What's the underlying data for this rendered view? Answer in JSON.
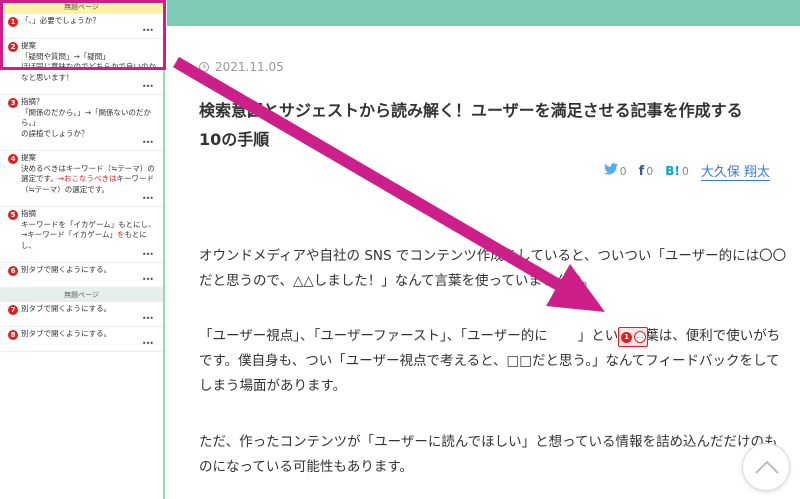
{
  "sidebar": {
    "section1_header": "無題ページ",
    "section2_header": "無題ページ",
    "comments": [
      {
        "num": "1",
        "title": "",
        "text": "「、」必要でしょうか？"
      },
      {
        "num": "2",
        "title": "提案",
        "text": "「疑問や質問」→「疑問」\nほぼ同じ意味なのでどちらかで良いのかなと思います！"
      },
      {
        "num": "3",
        "title": "指摘？",
        "text": "「関係のだから。」→「関係ないのだから。」\nの誤植でしょうか？"
      },
      {
        "num": "4",
        "title": "提案",
        "text_before": "決めるべきはキーワード（≒テーマ）の選定です。",
        "text_red": "→おこなうべきは",
        "text_after": "キーワード（≒テーマ）の選定です。"
      },
      {
        "num": "5",
        "title": "指摘",
        "text_before": "キーワードを「イカゲーム」もとにし、→キーワード「イカゲーム」",
        "text_red": "を",
        "text_after": "もとにし、"
      },
      {
        "num": "6",
        "title": "",
        "text": "別タブで開くようにする。"
      },
      {
        "num": "7",
        "title": "",
        "text": "別タブで開くようにする。"
      },
      {
        "num": "8",
        "title": "",
        "text": "別タブで開くようにする。"
      }
    ],
    "more_label": "•••"
  },
  "article": {
    "date": "2021.11.05",
    "title": "検索意図とサジェストから読み解く！ユーザーを満足させる記事を作成する10の手順",
    "share": {
      "twitter_count": "0",
      "facebook_count": "0",
      "hatena_label": "B!",
      "hatena_count": "0"
    },
    "author": "大久保 翔太",
    "p1": "オウンドメディアや自社の SNS でコンテンツ作成をしていると、ついつい「ユーザー的には〇〇だと思うので、△△しました！」なんて言葉を使っていませんか。",
    "p2_before": "「ユーザー視点」、「ユーザーファースト」、「ユーザー的に",
    "p2_after": "」という言葉は、便利で使いがちです。僕自身も、つい「ユーザー視点で考えると、□□だと思う。」なんてフィードバックをしてしまう場面があります。",
    "p3": "ただ、作ったコンテンツが「ユーザーに読んでほしい」と想っている情報を詰め込んだだけのものになっている可能性もあります。",
    "marker_num": "1",
    "marker_dots": "…"
  },
  "icons": {
    "clock": "clock-icon",
    "twitter": "twitter-icon",
    "facebook": "facebook-icon",
    "hatena": "hatena-bookmark-icon",
    "scroll_top": "chevron-up-icon"
  },
  "colors": {
    "accent_bar": "#7fcab6",
    "annotation": "#cc1f8a",
    "badge_red": "#e02020",
    "link_blue": "#3a7bd5"
  }
}
